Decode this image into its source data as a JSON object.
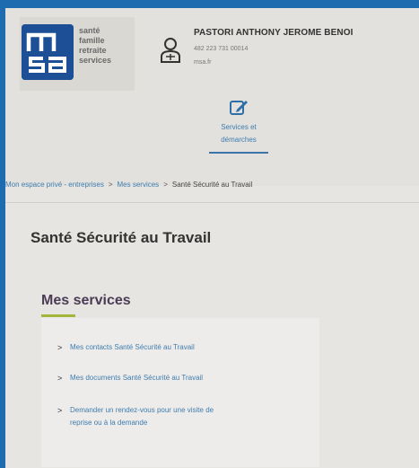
{
  "logo": {
    "lines": [
      "santé",
      "famille",
      "retraite",
      "services"
    ]
  },
  "user": {
    "name": "PASTORI ANTHONY JEROME BENOI",
    "siret": "482 223 731 00014",
    "domain": "msa.fr"
  },
  "nav": {
    "services_tab": {
      "label_line1": "Services et",
      "label_line2": "démarches",
      "icon": "edit-icon"
    }
  },
  "breadcrumb": {
    "items": [
      "Mon espace privé - entreprises",
      "Mes services",
      "Santé Sécurité au Travail"
    ],
    "separator": ">"
  },
  "page": {
    "title": "Santé Sécurité au Travail",
    "section_title": "Mes services"
  },
  "services": [
    {
      "label": "Mes contacts Santé Sécurité au Travail"
    },
    {
      "label": "Mes documents Santé Sécurité au Travail"
    },
    {
      "label_line1": "Demander un rendez-vous pour une visite de",
      "label_line2": "reprise ou à la demande"
    }
  ],
  "colors": {
    "frame_border": "#1f6bb0",
    "logo_blue": "#1c4f95",
    "link_blue": "#3f7db0",
    "accent_green": "#a5b43a",
    "section_title": "#4a3c56"
  }
}
